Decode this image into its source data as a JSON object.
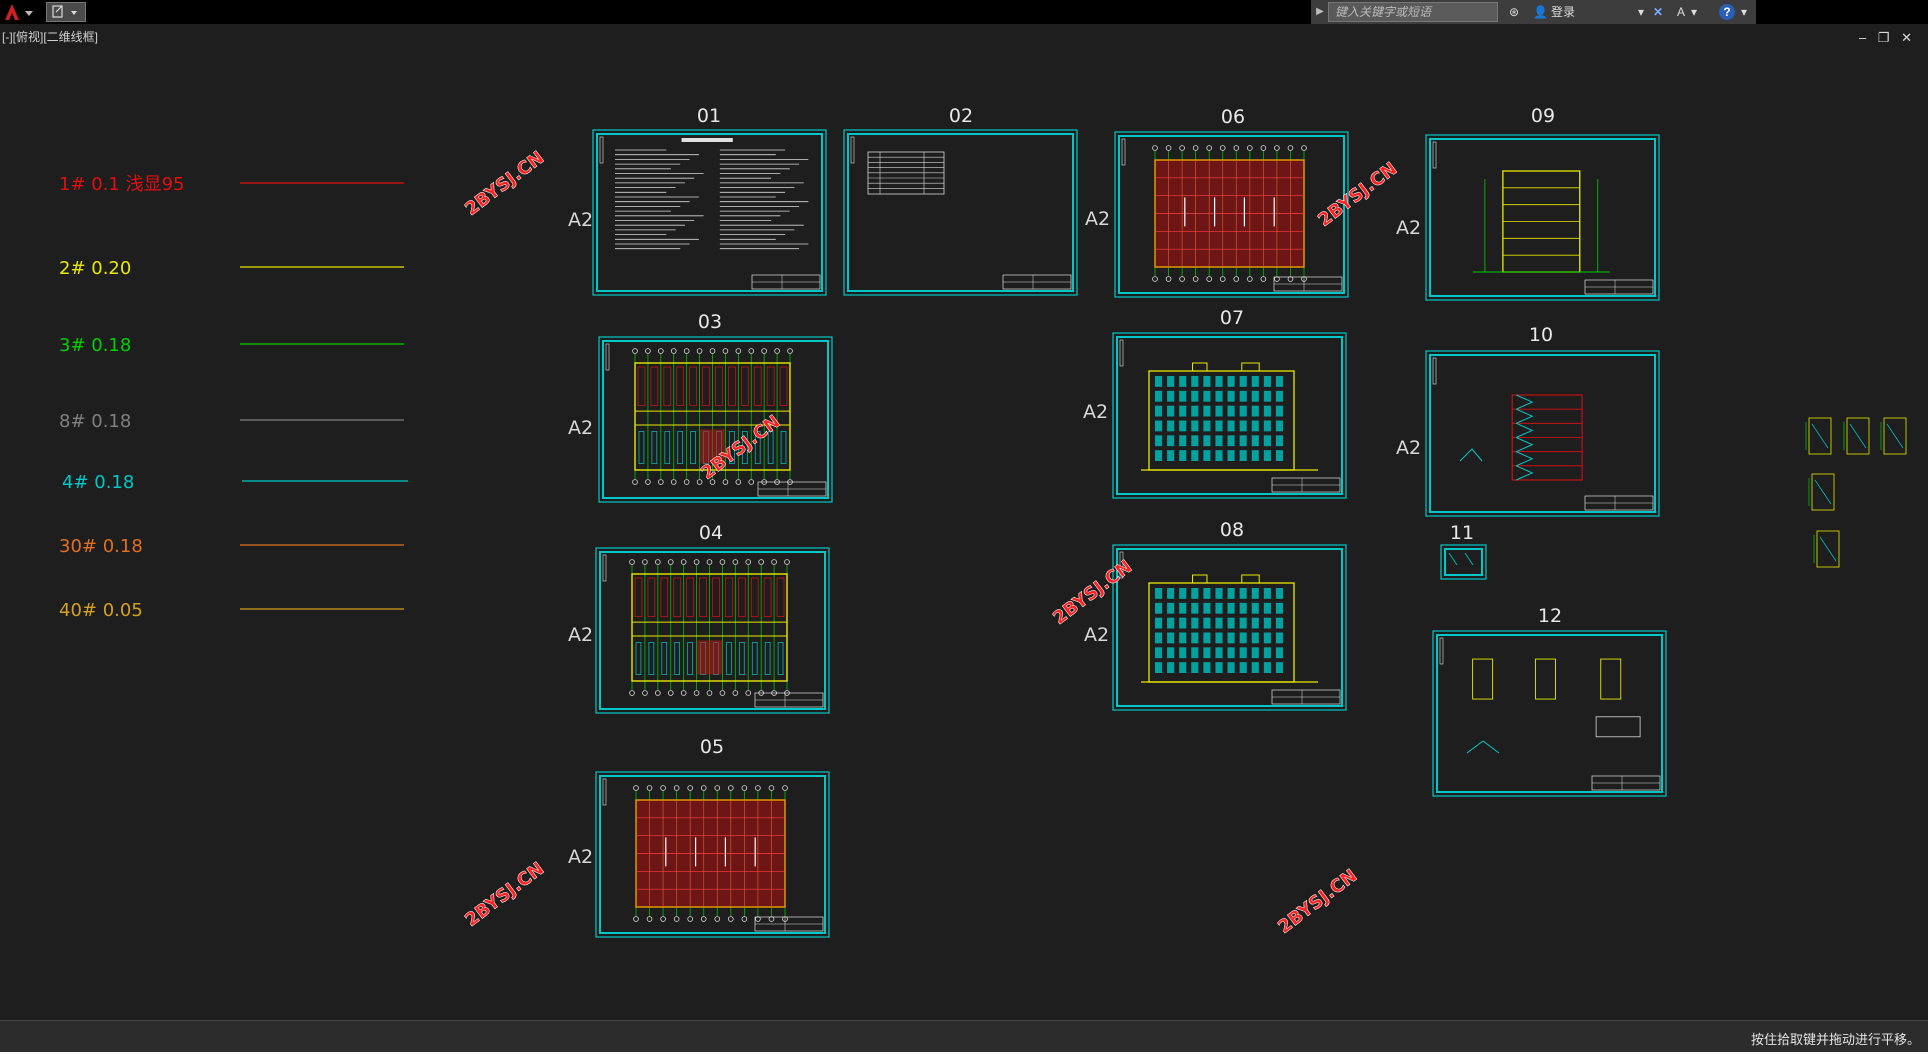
{
  "topbar": {
    "search_placeholder": "键入关键字或短语",
    "login_label": "登录",
    "help_label": "?"
  },
  "viewport": {
    "label": "[-][俯视][二维线框]"
  },
  "window_controls": {
    "minimize": "–",
    "restore": "❐",
    "close": "✕"
  },
  "colors": {
    "canvas_bg": "#1e1e1e",
    "frame": "#00c8c8",
    "red": "#e01010",
    "yellow": "#e8e800",
    "green": "#00d000",
    "grey": "#808080",
    "cyan": "#00c8c8",
    "orange": "#e07020",
    "gold": "#d4a020",
    "watermark": "#ff2020"
  },
  "layer_legend": [
    {
      "label": "1#  0.1   浅显95",
      "color": "#e01010"
    },
    {
      "label": "2#  0.20",
      "color": "#e8e800"
    },
    {
      "label": "3#  0.18",
      "color": "#00d000"
    },
    {
      "label": "8#  0.18",
      "color": "#808080"
    },
    {
      "label": "4#  0.18",
      "color": "#00c8c8"
    },
    {
      "label": "30#  0.18",
      "color": "#e07020"
    },
    {
      "label": "40#  0.05",
      "color": "#d4a020"
    }
  ],
  "sheets": [
    {
      "number": "01",
      "size": "A2",
      "kind": "notes"
    },
    {
      "number": "02",
      "size": "",
      "kind": "table"
    },
    {
      "number": "03",
      "size": "A2",
      "kind": "plan"
    },
    {
      "number": "04",
      "size": "A2",
      "kind": "plan"
    },
    {
      "number": "05",
      "size": "A2",
      "kind": "roof"
    },
    {
      "number": "06",
      "size": "A2",
      "kind": "roof"
    },
    {
      "number": "07",
      "size": "A2",
      "kind": "elevation"
    },
    {
      "number": "08",
      "size": "A2",
      "kind": "elevation"
    },
    {
      "number": "09",
      "size": "A2",
      "kind": "side"
    },
    {
      "number": "10",
      "size": "A2",
      "kind": "section"
    },
    {
      "number": "11",
      "size": "",
      "kind": "small"
    },
    {
      "number": "12",
      "size": "",
      "kind": "details"
    }
  ],
  "watermark_text": "2BYSJ.CN",
  "status": {
    "message": "按住拾取键并拖动进行平移。"
  }
}
